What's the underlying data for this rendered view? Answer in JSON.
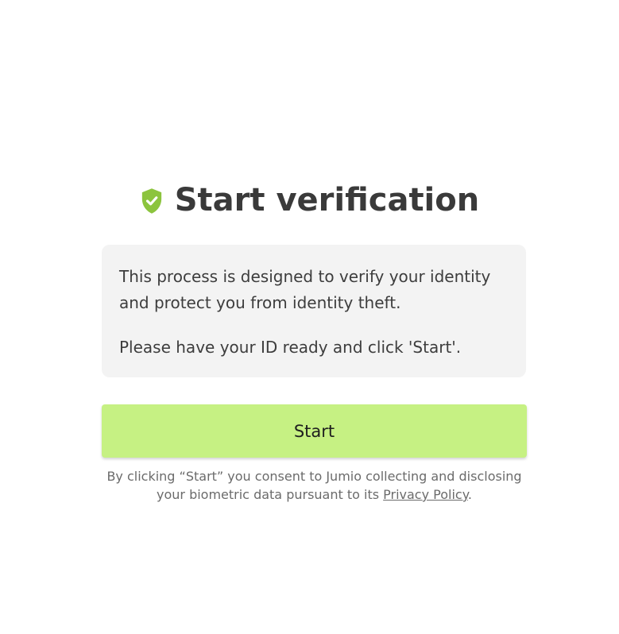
{
  "header": {
    "title": "Start verification",
    "icon": "shield-check-icon",
    "icon_color": "#8cc43e"
  },
  "info": {
    "paragraph_1": "This process is designed to verify your identity and protect you from identity theft.",
    "paragraph_2": "Please have your ID ready and click 'Start'."
  },
  "start_button": {
    "label": "Start",
    "color": "#c6f183"
  },
  "consent": {
    "text_before": "By clicking “Start” you consent to Jumio collecting and disclosing your biometric data pursuant to its ",
    "link_label": "Privacy Policy",
    "text_after": "."
  }
}
